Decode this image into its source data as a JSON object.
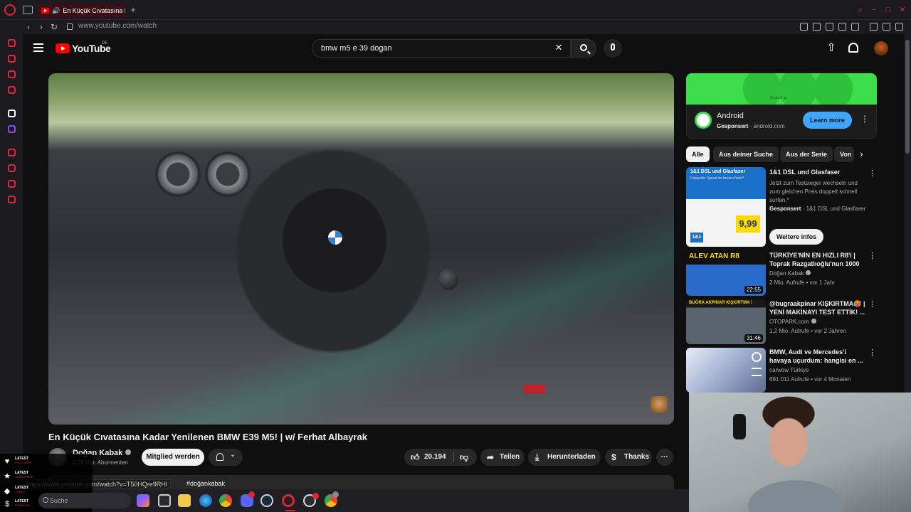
{
  "browser": {
    "tab_title": "En Küçük Cıvatasına K",
    "new_tab_label": "+",
    "url": "www.youtube.com/watch",
    "window_controls": [
      "search-icon",
      "minimize-icon",
      "maximize-icon",
      "close-icon"
    ]
  },
  "header": {
    "logo_text": "YouTube",
    "region": "DE",
    "search_query": "bmw m5 e 39 dogan"
  },
  "video": {
    "title": "En Küçük Cıvatasına Kadar Yenilenen BMW E39 M5! | w/ Ferhat Albayrak",
    "channel": "Doğan Kabak",
    "subscribers": "2,78 Mio. Abonnenten",
    "join_label": "Mitglied werden",
    "likes": "20.194",
    "share_label": "Teilen",
    "download_label": "Herunterladen",
    "thanks_label": "Thanks",
    "description_tag": "#doğankabak",
    "status_url": "https://www.youtube.com/watch?v=T50HQre9RHI"
  },
  "ad": {
    "banner_logo": "Android ▲",
    "title": "Android",
    "sponsored": "Gesponsert",
    "domain": "android.com",
    "cta": "Learn more"
  },
  "chips": [
    "Alle",
    "Aus deiner Suche",
    "Aus der Serie",
    "Von"
  ],
  "sponsor_rec": {
    "thumb_head": "1&1 DSL und Glasfaser",
    "thumb_sub": "Doppelter Speed im besten Netz!*",
    "price": "9,99",
    "badge": "1&1",
    "title": "1&1 DSL und Glasfaser",
    "description": "Jetzt zum Testsieger wechseln und zum gleichen Preis doppelt schnell surfen.*",
    "sponsored": "Gesponsert",
    "advertiser": "1&1 DSL und Glasfaser",
    "cta": "Weitere infos"
  },
  "recommendations": [
    {
      "title": "TÜRKİYE'NİN EN HIZLI R8'i | Toprak Razgatlıoğlu'nun 1000 ...",
      "channel": "Doğan Kabak",
      "meta": "2 Mio. Aufrufe • vor 1 Jahr",
      "duration": "22:55",
      "thumb_text": "ALEV ATAN R8",
      "color": "#2a6ac8"
    },
    {
      "title": "@bugraakpinar KIŞKIRTMA🥵 | YENİ MAKİNAYI TEST ETTİK! ...",
      "channel": "OTOPARK.com",
      "meta": "1,2 Mio. Aufrufe • vor 2 Jahren",
      "duration": "31:46",
      "thumb_text": "BUĞRA AKPINAR KIŞKIRTMA !",
      "color": "#3a3f46"
    },
    {
      "title": "BMW, Audi ve Mercedes'i havaya uçurdum: hangisi en ...",
      "channel": "carwow Türkiye",
      "meta": "691.011 Aufrufe • vor 4 Monaten",
      "duration": "",
      "thumb_text": "",
      "color": "#a8b6d6"
    }
  ],
  "stream_alerts": [
    {
      "icon": "♥",
      "label": "LATEST",
      "sub": "FOLLOWER"
    },
    {
      "icon": "★",
      "label": "LATEST",
      "sub": "SUBSCRIBER"
    },
    {
      "icon": "◆",
      "label": "LATEST",
      "sub": "CHEER"
    },
    {
      "icon": "$",
      "label": "LATEST",
      "sub": "DONATION"
    }
  ],
  "taskbar": {
    "search_placeholder": "Suche"
  }
}
